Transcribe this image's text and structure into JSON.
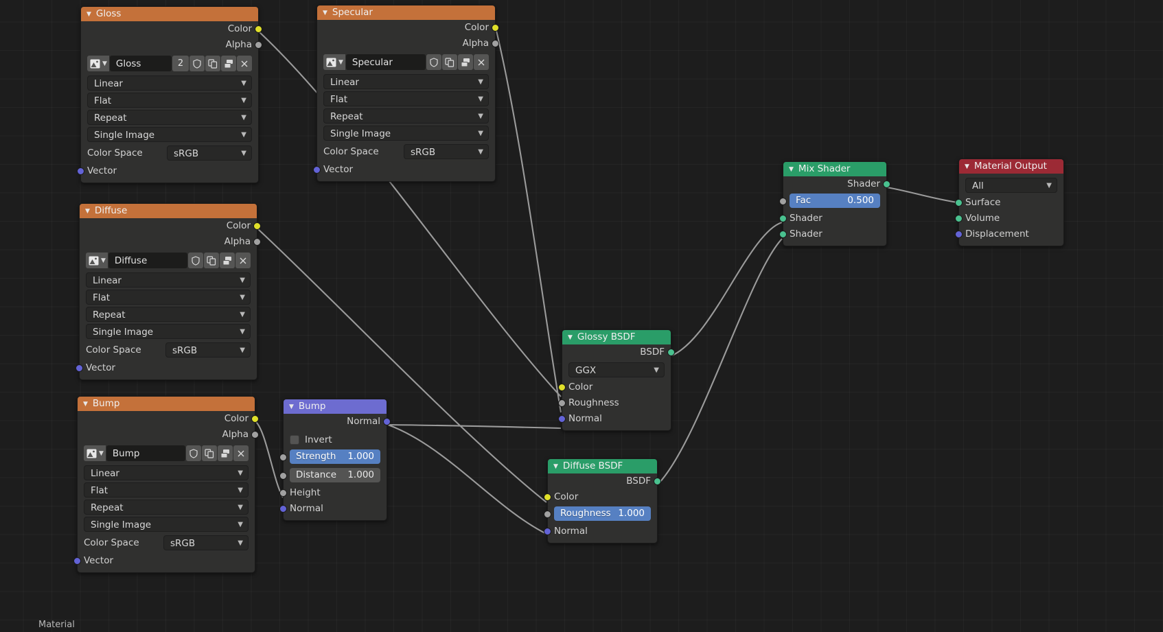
{
  "editor": {
    "breadcrumb": "Material",
    "background": "#1d1d1d"
  },
  "colors": {
    "texture_header": "#c4713a",
    "vector_header": "#6d6cd0",
    "shader_header": "#2a9d68",
    "output_header": "#9c2a35",
    "socket_color": "#e0e02a",
    "socket_grey": "#a1a1a1",
    "socket_vector": "#6363d6",
    "socket_shader": "#4ac18f",
    "slider_active": "#5680c2"
  },
  "nodes": {
    "gloss": {
      "title": "Gloss",
      "outputs": [
        "Color",
        "Alpha"
      ],
      "image_name": "Gloss",
      "users": "2",
      "interpolation": "Linear",
      "projection": "Flat",
      "extension": "Repeat",
      "source": "Single Image",
      "colorspace_label": "Color Space",
      "colorspace": "sRGB",
      "inputs": [
        "Vector"
      ],
      "icons": {
        "browse": "image-datablock-icon",
        "chevron": "chevron-down-icon",
        "fake_user": "shield-icon",
        "new": "duplicate-icon",
        "unlink_render": "render-icon",
        "close": "close-icon"
      }
    },
    "specular": {
      "title": "Specular",
      "outputs": [
        "Color",
        "Alpha"
      ],
      "image_name": "Specular",
      "users": "",
      "interpolation": "Linear",
      "projection": "Flat",
      "extension": "Repeat",
      "source": "Single Image",
      "colorspace_label": "Color Space",
      "colorspace": "sRGB",
      "inputs": [
        "Vector"
      ]
    },
    "diffuse_tex": {
      "title": "Diffuse",
      "outputs": [
        "Color",
        "Alpha"
      ],
      "image_name": "Diffuse",
      "users": "",
      "interpolation": "Linear",
      "projection": "Flat",
      "extension": "Repeat",
      "source": "Single Image",
      "colorspace_label": "Color Space",
      "colorspace": "sRGB",
      "inputs": [
        "Vector"
      ]
    },
    "bump_tex": {
      "title": "Bump",
      "outputs": [
        "Color",
        "Alpha"
      ],
      "image_name": "Bump",
      "users": "",
      "interpolation": "Linear",
      "projection": "Flat",
      "extension": "Repeat",
      "source": "Single Image",
      "colorspace_label": "Color Space",
      "colorspace": "sRGB",
      "inputs": [
        "Vector"
      ]
    },
    "bump": {
      "title": "Bump",
      "output": "Normal",
      "invert_label": "Invert",
      "invert_checked": false,
      "strength_label": "Strength",
      "strength_value": "1.000",
      "distance_label": "Distance",
      "distance_value": "1.000",
      "height_label": "Height",
      "normal_label": "Normal"
    },
    "glossy_bsdf": {
      "title": "Glossy BSDF",
      "output": "BSDF",
      "distribution": "GGX",
      "inputs": [
        "Color",
        "Roughness",
        "Normal"
      ]
    },
    "diffuse_bsdf": {
      "title": "Diffuse BSDF",
      "output": "BSDF",
      "color_label": "Color",
      "roughness_label": "Roughness",
      "roughness_value": "1.000",
      "normal_label": "Normal"
    },
    "mix_shader": {
      "title": "Mix Shader",
      "output": "Shader",
      "fac_label": "Fac",
      "fac_value": "0.500",
      "shader_a": "Shader",
      "shader_b": "Shader"
    },
    "material_output": {
      "title": "Material Output",
      "target": "All",
      "inputs": [
        "Surface",
        "Volume",
        "Displacement"
      ]
    }
  }
}
